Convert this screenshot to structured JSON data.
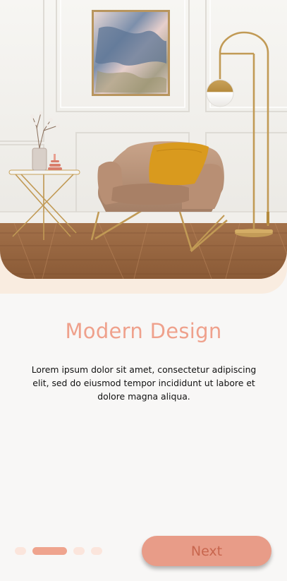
{
  "onboarding": {
    "title": "Modern Design",
    "description": "Lorem ipsum dolor sit amet, consectetur adipiscing elit, sed do eiusmod tempor incididunt ut labore et dolore magna aliqua.",
    "next_label": "Next",
    "page_indicator": {
      "total_pages": 4,
      "current_page": 2
    }
  },
  "colors": {
    "accent": "#efa18c",
    "button": "#e89c88",
    "button_text": "#c8664e",
    "hero_backdrop": "#f9ece0",
    "background": "#f8f7f6"
  }
}
